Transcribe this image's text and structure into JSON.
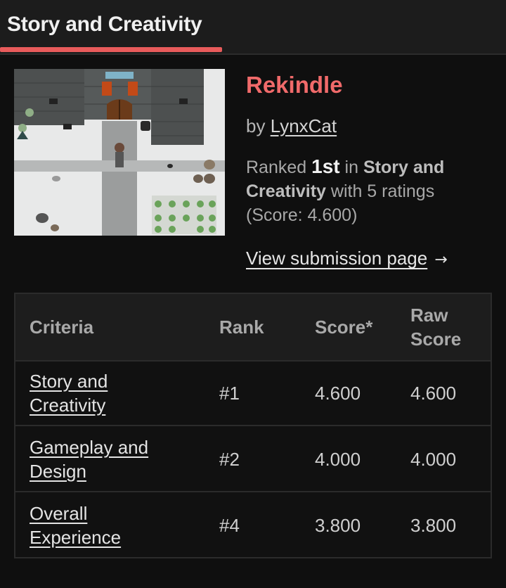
{
  "tab": {
    "label": "Story and Creativity"
  },
  "game": {
    "title": "Rekindle",
    "by_prefix": "by",
    "author": "LynxCat",
    "rank_prefix": "Ranked",
    "rank": "1st",
    "rank_in": "in",
    "category": "Story and Creativity",
    "ratings_text": "with 5 ratings",
    "score_text": "(Score: 4.600)",
    "view_link": "View submission page",
    "arrow_icon": "→"
  },
  "table": {
    "headers": {
      "criteria": "Criteria",
      "rank": "Rank",
      "score": "Score*",
      "raw_score_1": "Raw",
      "raw_score_2": "Score"
    },
    "rows": [
      {
        "criteria_1": "Story and",
        "criteria_2": "Creativity",
        "rank": "#1",
        "score": "4.600",
        "raw": "4.600"
      },
      {
        "criteria_1": "Gameplay and",
        "criteria_2": "Design",
        "rank": "#2",
        "score": "4.000",
        "raw": "4.000"
      },
      {
        "criteria_1": "Overall",
        "criteria_2": "Experience",
        "rank": "#4",
        "score": "3.800",
        "raw": "3.800"
      }
    ]
  },
  "colors": {
    "accent": "#e85b5b",
    "title": "#f06a6a",
    "background": "#0f0f0f"
  }
}
